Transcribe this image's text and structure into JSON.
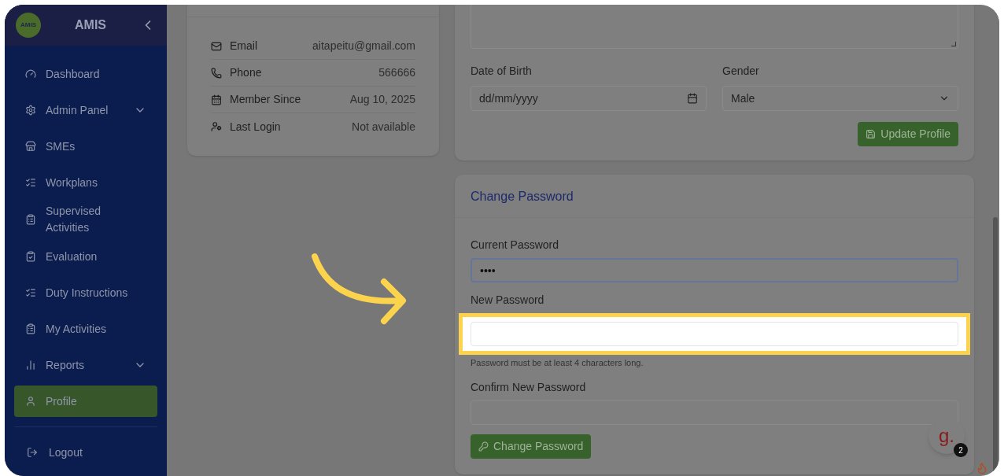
{
  "sidebar": {
    "logo_text": "AMIS",
    "brand": "AMIS",
    "items": [
      {
        "label": "Dashboard",
        "expandable": false,
        "selected": false
      },
      {
        "label": "Admin Panel",
        "expandable": true,
        "selected": false
      },
      {
        "label": "SMEs",
        "expandable": false,
        "selected": false
      },
      {
        "label": "Workplans",
        "expandable": false,
        "selected": false
      },
      {
        "label": "Supervised Activities",
        "expandable": false,
        "selected": false
      },
      {
        "label": "Evaluation",
        "expandable": false,
        "selected": false
      },
      {
        "label": "Duty Instructions",
        "expandable": false,
        "selected": false
      },
      {
        "label": "My Activities",
        "expandable": false,
        "selected": false
      },
      {
        "label": "Reports",
        "expandable": true,
        "selected": false
      },
      {
        "label": "Profile",
        "expandable": false,
        "selected": true
      }
    ],
    "footer_items": [
      {
        "label": "Logout"
      }
    ]
  },
  "contact_card": {
    "rows": [
      {
        "label": "Email",
        "value": "aitapeitu@gmail.com"
      },
      {
        "label": "Phone",
        "value": "566666"
      },
      {
        "label": "Member Since",
        "value": "Aug 10, 2025"
      },
      {
        "label": "Last Login",
        "value": "Not available"
      }
    ]
  },
  "profile_form": {
    "fields": [
      {
        "kind": "date",
        "label": "Date of Birth",
        "placeholder": "dd/mm/yyyy"
      },
      {
        "kind": "select",
        "label": "Gender",
        "value": "Male"
      }
    ],
    "submit": "Update Profile"
  },
  "password_form": {
    "title": "Change Password",
    "fields": [
      {
        "label": "Current Password",
        "value": "••••",
        "focused": true,
        "highlighted": false
      },
      {
        "label": "New Password",
        "hint": "Password must be at least 4 characters long.",
        "focused": false,
        "highlighted": true
      },
      {
        "label": "Confirm New Password",
        "focused": false,
        "highlighted": false
      }
    ],
    "submit": "Change Password"
  },
  "chat_widget": {
    "logo": "g.",
    "count": "2"
  }
}
